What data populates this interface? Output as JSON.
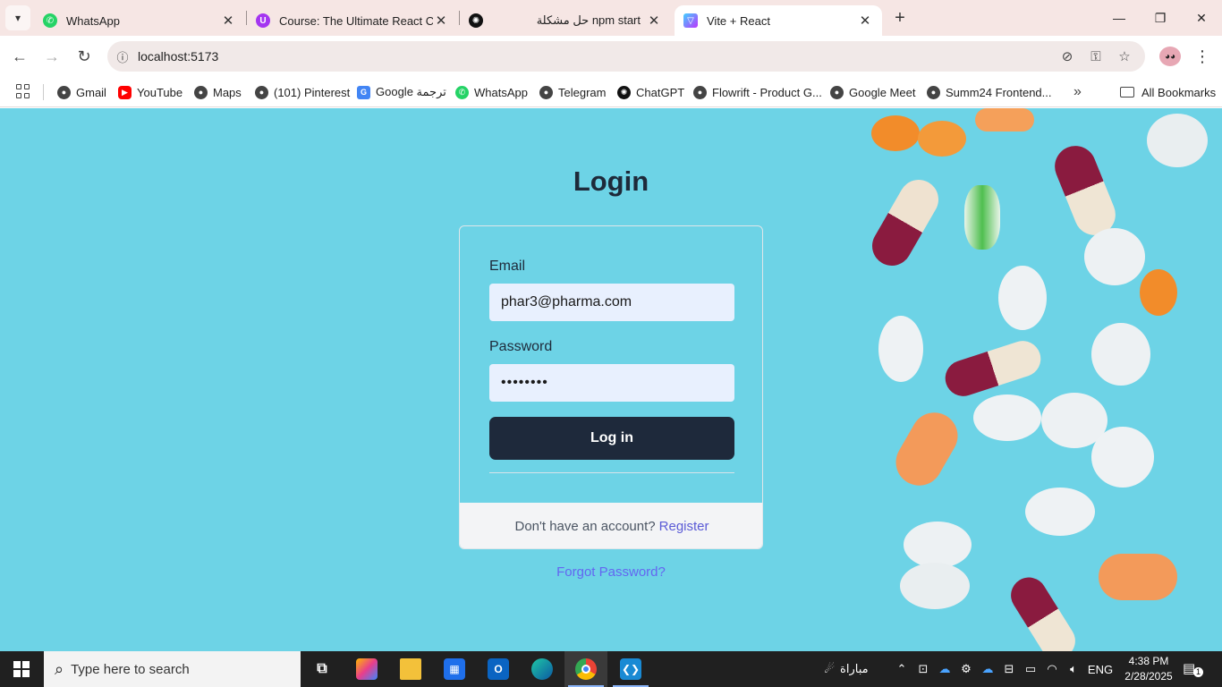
{
  "browser": {
    "tabs": [
      {
        "title": "WhatsApp",
        "icon": "whatsapp-icon",
        "color": "#25d366",
        "active": false
      },
      {
        "title": "Course: The Ultimate React Cou",
        "icon": "udemy-icon",
        "color": "#a435f0",
        "active": false
      },
      {
        "title": "حل مشكلة npm start",
        "icon": "chatgpt-icon",
        "color": "#111111",
        "active": false
      },
      {
        "title": "Vite + React",
        "icon": "vite-icon",
        "color": "#8b5cf6",
        "active": true
      }
    ],
    "address": "localhost:5173"
  },
  "bookmarks": {
    "items": [
      {
        "label": "Gmail",
        "icon": "globe-icon",
        "color": "#444444"
      },
      {
        "label": "YouTube",
        "icon": "youtube-icon",
        "color": "#ff0000"
      },
      {
        "label": "Maps",
        "icon": "globe-icon",
        "color": "#444444"
      },
      {
        "label": "(101) Pinterest",
        "icon": "globe-icon",
        "color": "#444444"
      },
      {
        "label": "Google ترجمة",
        "icon": "google-translate-icon",
        "color": "#4285f4"
      },
      {
        "label": "WhatsApp",
        "icon": "whatsapp-icon",
        "color": "#25d366"
      },
      {
        "label": "Telegram",
        "icon": "globe-icon",
        "color": "#444444"
      },
      {
        "label": "ChatGPT",
        "icon": "chatgpt-icon",
        "color": "#111111"
      },
      {
        "label": "Flowrift - Product G...",
        "icon": "globe-icon",
        "color": "#444444"
      },
      {
        "label": "Google Meet",
        "icon": "globe-icon",
        "color": "#444444"
      },
      {
        "label": "Summ24 Frontend...",
        "icon": "globe-icon",
        "color": "#444444"
      }
    ],
    "all_bookmarks": "All Bookmarks"
  },
  "page": {
    "title": "Login",
    "email_label": "Email",
    "email_value": "phar3@pharma.com",
    "password_label": "Password",
    "password_value": "••••••••",
    "login_button": "Log in",
    "no_account_text": "Don't have an account?",
    "register_link": "Register",
    "forgot_link": "Forgot Password?",
    "background_color": "#6dd3e6",
    "button_color": "#1e293b",
    "link_color": "#6366f1"
  },
  "taskbar": {
    "search_placeholder": "Type here to search",
    "weather_text": "مباراة",
    "language": "ENG",
    "time": "4:38 PM",
    "date": "2/28/2025",
    "notification_count": "1"
  }
}
